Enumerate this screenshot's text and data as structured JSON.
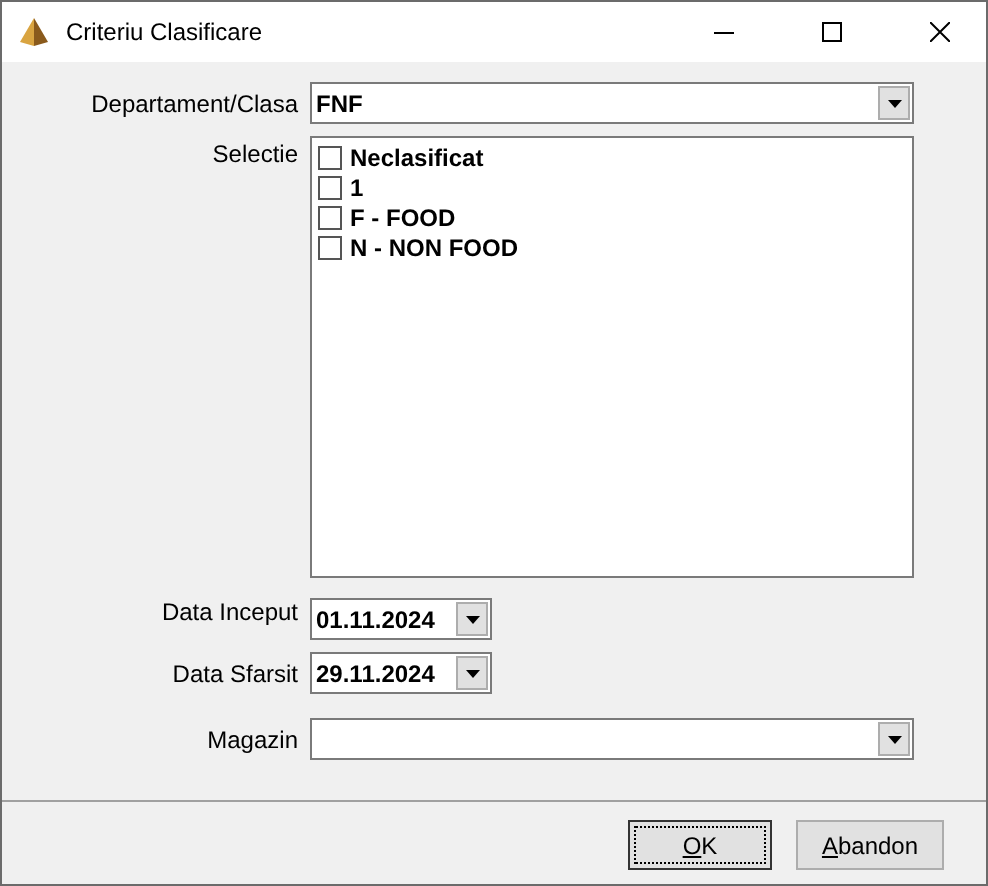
{
  "window": {
    "title": "Criteriu Clasificare"
  },
  "department": {
    "label": "Departament/Clasa",
    "value": "FNF"
  },
  "selection": {
    "label": "Selectie",
    "items": [
      {
        "label": "Neclasificat",
        "checked": false
      },
      {
        "label": "1",
        "checked": false
      },
      {
        "label": "F - FOOD",
        "checked": false
      },
      {
        "label": "N - NON FOOD",
        "checked": false
      }
    ]
  },
  "start_date": {
    "label": "Data Inceput",
    "value": "01.11.2024"
  },
  "end_date": {
    "label": "Data Sfarsit",
    "value": "29.11.2024"
  },
  "store": {
    "label": "Magazin"
  },
  "buttons": [
    {
      "label": [
        {
          "text": "O",
          "underlined": true
        },
        {
          "text": "K",
          "underlined": false
        }
      ],
      "default": true
    },
    {
      "label": [
        {
          "text": "A",
          "underlined": true
        },
        {
          "text": "bandon",
          "underlined": false
        }
      ],
      "default": false
    }
  ]
}
